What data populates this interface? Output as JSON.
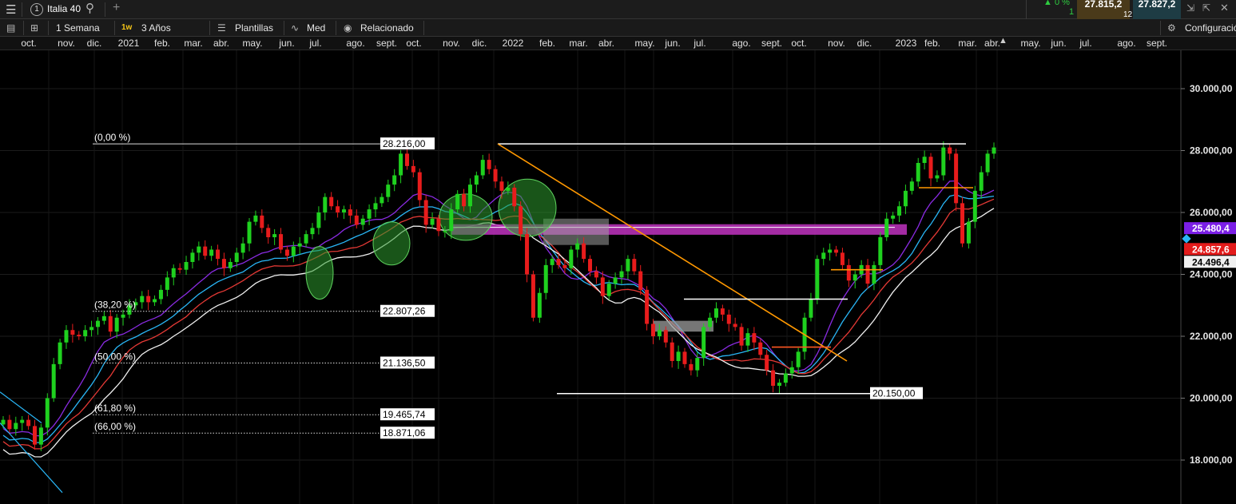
{
  "header": {
    "menu_icon": "hamburger-icon",
    "badge_number": "1",
    "instrument": "Italia 40",
    "change_up": "▲ 0 %",
    "change_count": "1",
    "bid": "27.815,2",
    "spread": "12,0",
    "ask": "27.827,2"
  },
  "toolbar": {
    "interval_label": "1 Semana",
    "interval_tag": "1w",
    "range_label": "3 Años",
    "templates_label": "Plantillas",
    "indicator_label": "Med",
    "related_label": "Relacionado",
    "settings_label": "Configuración"
  },
  "months": [
    "oct.",
    "nov.",
    "dic.",
    "2021",
    "feb.",
    "mar.",
    "abr.",
    "may.",
    "jun.",
    "jul.",
    "ago.",
    "sept.",
    "oct.",
    "nov.",
    "dic.",
    "2022",
    "feb.",
    "mar.",
    "abr.",
    "may.",
    "jun.",
    "jul.",
    "ago.",
    "sept.",
    "oct.",
    "nov.",
    "dic.",
    "2023",
    "feb.",
    "mar.",
    "abr.",
    "may.",
    "jun.",
    "jul.",
    "ago.",
    "sept."
  ],
  "colors": {
    "up": "#1fd11f",
    "down": "#e81c1c",
    "ma_purple": "#8a2be2",
    "ma_blue": "#29b6f6",
    "ma_red": "#e53935",
    "ma_white": "#f0f0f0",
    "trendline": "#ff9800",
    "zone_magenta": "#c032c0",
    "zone_grey": "#9e9e9e",
    "price_tag_purple": "#7b1fe6",
    "price_tag_red": "#e31b1b"
  },
  "chart_data": {
    "type": "candlestick",
    "title": "Italia 40",
    "interval": "1 Semana",
    "range": "3 Años",
    "ylim": [
      16800,
      31200
    ],
    "y_ticks": [
      {
        "v": 30000,
        "label": "30.000,00"
      },
      {
        "v": 28000,
        "label": "28.000,00"
      },
      {
        "v": 26000,
        "label": "26.000,00"
      },
      {
        "v": 24000,
        "label": "24.000,00"
      },
      {
        "v": 22000,
        "label": "22.000,00"
      },
      {
        "v": 20000,
        "label": "20.000,00"
      },
      {
        "v": 18000,
        "label": "18.000,00"
      }
    ],
    "closes": [
      19300,
      19000,
      19200,
      19300,
      19100,
      18500,
      19050,
      20000,
      21100,
      21800,
      22200,
      22050,
      22000,
      22200,
      22300,
      22500,
      22650,
      22150,
      22600,
      22700,
      23000,
      23100,
      23300,
      23100,
      23200,
      23500,
      23900,
      24200,
      24150,
      24400,
      24700,
      24900,
      24600,
      24800,
      24500,
      24200,
      24400,
      24700,
      25000,
      25700,
      25900,
      25500,
      25200,
      25300,
      24800,
      24600,
      24900,
      25000,
      25300,
      25500,
      26000,
      26500,
      26200,
      26000,
      26100,
      25900,
      25600,
      25800,
      26100,
      26300,
      26500,
      26900,
      27200,
      27900,
      27500,
      27300,
      26400,
      25600,
      25800,
      25400,
      25400,
      26100,
      26600,
      26200,
      26900,
      27200,
      27700,
      27400,
      27000,
      26700,
      26800,
      26200,
      25300,
      24000,
      22600,
      23400,
      24300,
      24500,
      24300,
      24200,
      24800,
      25000,
      24500,
      24100,
      23900,
      23300,
      23700,
      23900,
      24100,
      24500,
      24100,
      23500,
      22400,
      22000,
      22200,
      21800,
      21200,
      21500,
      21100,
      20900,
      21300,
      22300,
      22600,
      22900,
      22700,
      22400,
      22300,
      21700,
      22100,
      21800,
      21400,
      20900,
      20400,
      20500,
      20800,
      21000,
      21500,
      22600,
      23200,
      24500,
      24700,
      24800,
      24700,
      24300,
      23800,
      24000,
      24300,
      23700,
      24300,
      25200,
      25800,
      25900,
      26200,
      26700,
      27000,
      27600,
      27800,
      27100,
      27200,
      28100,
      27900,
      26300,
      25000,
      25700,
      26700,
      27300,
      27900,
      28100
    ],
    "moving_averages": [
      {
        "color": "purple",
        "last": 25480.4
      },
      {
        "color": "blue",
        "last": 25100
      },
      {
        "color": "red",
        "last": 24857.6
      },
      {
        "color": "white",
        "last": 24496.4
      }
    ],
    "fibonacci": [
      {
        "pct": "(0,00 %)",
        "value": 28216.0,
        "label": "28.216,00"
      },
      {
        "pct": "(38,20 %)",
        "value": 22807.26,
        "label": "22.807,26"
      },
      {
        "pct": "(50,00 %)",
        "value": 21136.5,
        "label": "21.136,50"
      },
      {
        "pct": "(61,80 %)",
        "value": 19465.74,
        "label": "19.465,74"
      },
      {
        "pct": "(66,00 %)",
        "value": 18871.06,
        "label": "18.871,06"
      }
    ],
    "level_labels": [
      {
        "value": 20150.0,
        "label": "20.150,00"
      }
    ],
    "price_tags": [
      {
        "value": 25480.4,
        "label": "25.480,4",
        "bg": "#7b1fe6",
        "fg": "#ffffff"
      },
      {
        "value": 24857.6,
        "label": "24.857,6",
        "bg": "#e31b1b",
        "fg": "#ffffff"
      },
      {
        "value": 24496.4,
        "label": "24.496,4",
        "bg": "#f0f0f0",
        "fg": "#000000"
      }
    ]
  }
}
